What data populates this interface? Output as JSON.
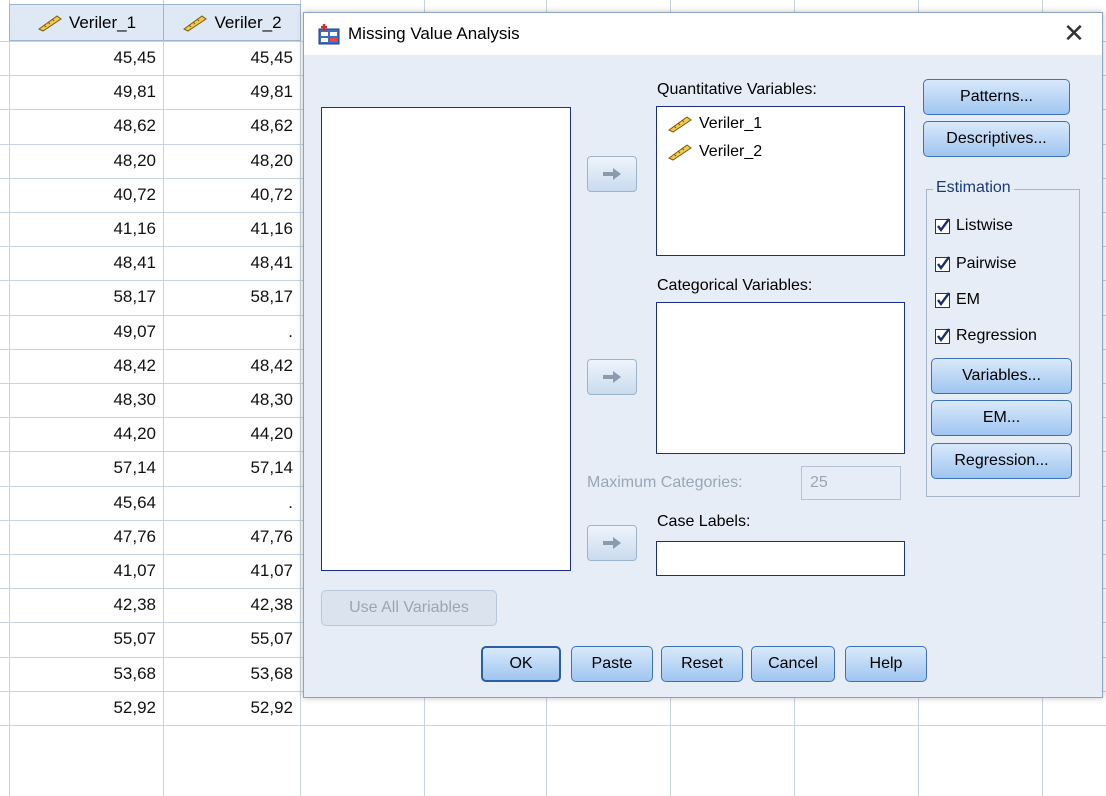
{
  "grid": {
    "columns": [
      "Veriler_1",
      "Veriler_2"
    ],
    "rows": [
      [
        "45,45",
        "45,45"
      ],
      [
        "49,81",
        "49,81"
      ],
      [
        "48,62",
        "48,62"
      ],
      [
        "48,20",
        "48,20"
      ],
      [
        "40,72",
        "40,72"
      ],
      [
        "41,16",
        "41,16"
      ],
      [
        "48,41",
        "48,41"
      ],
      [
        "58,17",
        "58,17"
      ],
      [
        "49,07",
        "."
      ],
      [
        "48,42",
        "48,42"
      ],
      [
        "48,30",
        "48,30"
      ],
      [
        "44,20",
        "44,20"
      ],
      [
        "57,14",
        "57,14"
      ],
      [
        "45,64",
        "."
      ],
      [
        "47,76",
        "47,76"
      ],
      [
        "41,07",
        "41,07"
      ],
      [
        "42,38",
        "42,38"
      ],
      [
        "55,07",
        "55,07"
      ],
      [
        "53,68",
        "53,68"
      ],
      [
        "52,92",
        "52,92"
      ]
    ]
  },
  "dialog": {
    "title": "Missing Value Analysis",
    "close_icon": "close-icon",
    "quantitative_label": "Quantitative Variables:",
    "quantitative_items": [
      "Veriler_1",
      "Veriler_2"
    ],
    "categorical_label": "Categorical Variables:",
    "max_categories_label": "Maximum Categories:",
    "max_categories_value": "25",
    "case_labels_label": "Case Labels:",
    "use_all_button": "Use All Variables",
    "side_buttons": {
      "patterns": "Patterns...",
      "descriptives": "Descriptives..."
    },
    "estimation": {
      "legend": "Estimation",
      "checks": [
        {
          "label": "Listwise",
          "checked": true
        },
        {
          "label": "Pairwise",
          "checked": true
        },
        {
          "label": "EM",
          "checked": true
        },
        {
          "label": "Regression",
          "checked": true
        }
      ],
      "buttons": {
        "variables": "Variables...",
        "em": "EM...",
        "regression": "Regression..."
      }
    },
    "bottom_buttons": {
      "ok": "OK",
      "paste": "Paste",
      "reset": "Reset",
      "cancel": "Cancel",
      "help": "Help"
    }
  }
}
